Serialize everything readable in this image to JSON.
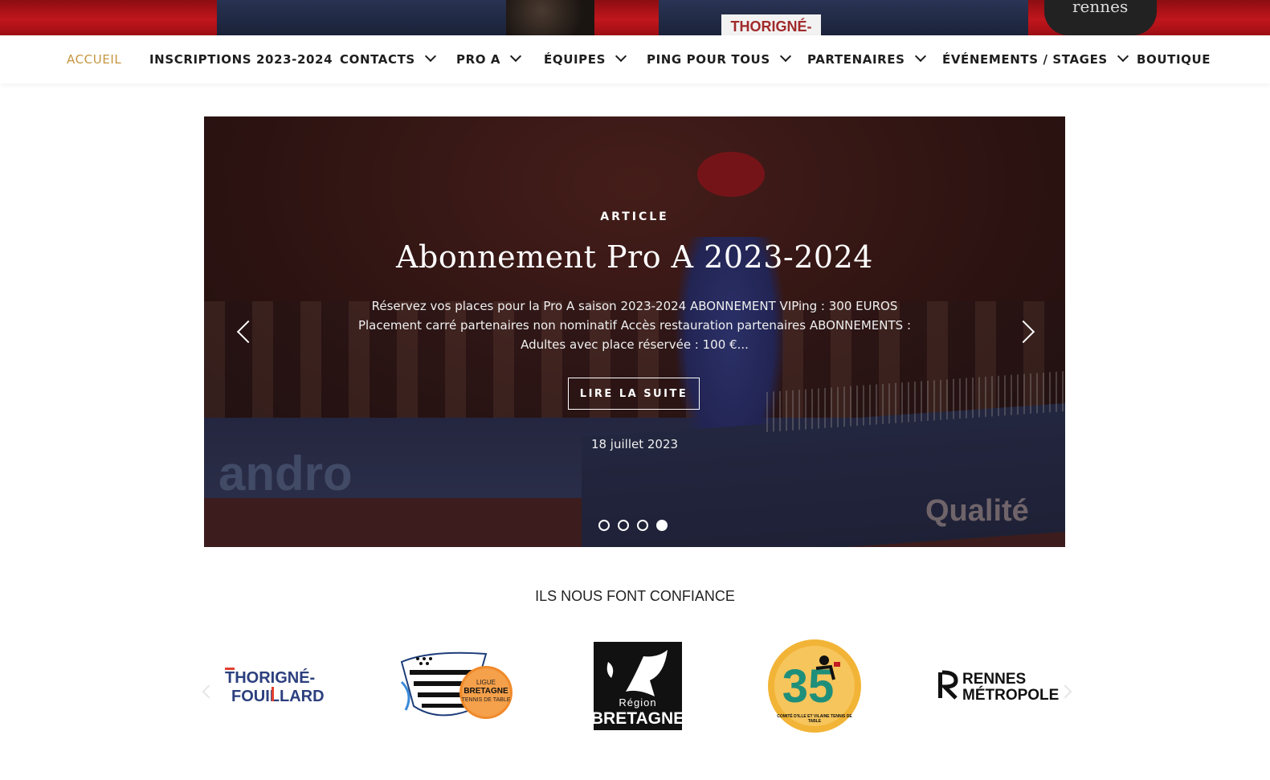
{
  "hero": {
    "strip_texts": [
      "rennes",
      "THORIGNÉ-"
    ]
  },
  "nav": {
    "items": [
      {
        "label": "ACCUEIL",
        "active": true,
        "dropdown": false
      },
      {
        "label": "INSCRIPTIONS 2023-2024",
        "active": false,
        "dropdown": false
      },
      {
        "label": "CONTACTS",
        "active": false,
        "dropdown": true
      },
      {
        "label": "PRO A",
        "active": false,
        "dropdown": true
      },
      {
        "label": "ÉQUIPES",
        "active": false,
        "dropdown": true
      },
      {
        "label": "PING POUR TOUS",
        "active": false,
        "dropdown": true
      },
      {
        "label": "PARTENAIRES",
        "active": false,
        "dropdown": true
      },
      {
        "label": "ÉVÉNEMENTS / STAGES",
        "active": false,
        "dropdown": true
      },
      {
        "label": "BOUTIQUE",
        "active": false,
        "dropdown": false
      }
    ],
    "active_color": "#c6953e"
  },
  "slider": {
    "kicker": "ARTICLE",
    "title": "Abonnement Pro A 2023-2024",
    "excerpt": "Réservez vos places pour la Pro A saison 2023-2024 ABONNEMENT VIPing : 300 EUROS Placement carré partenaires non nominatif Accès restauration partenaires ABONNEMENTS : Adultes avec place réservée : 100 €...",
    "read_more": "LIRE LA SUITE",
    "date": "18 juillet 2023",
    "dots_count": 4,
    "active_dot": 4,
    "bg_texts": {
      "brand1": "andro",
      "brand2": "Qualité"
    }
  },
  "partners": {
    "title": "ILS NOUS FONT CONFIANCE",
    "logos": [
      {
        "name": "thorigne-fouillard",
        "line1": "THORIGNÉ-",
        "line2": "FOUILLARD"
      },
      {
        "name": "ligue-bretagne",
        "line1": "LIGUE",
        "line2": "BRETAGNE",
        "line3": "TENNIS DE TABLE"
      },
      {
        "name": "region-bretagne",
        "line1": "Région",
        "line2": "BRETAGNE"
      },
      {
        "name": "comite-35",
        "number": "35",
        "caption": "COMITÉ D'ILLE ET VILAINE TENNIS DE TABLE"
      },
      {
        "name": "rennes-metropole",
        "line1": "RENNES",
        "line2": "MÉTROPOLE"
      }
    ]
  }
}
